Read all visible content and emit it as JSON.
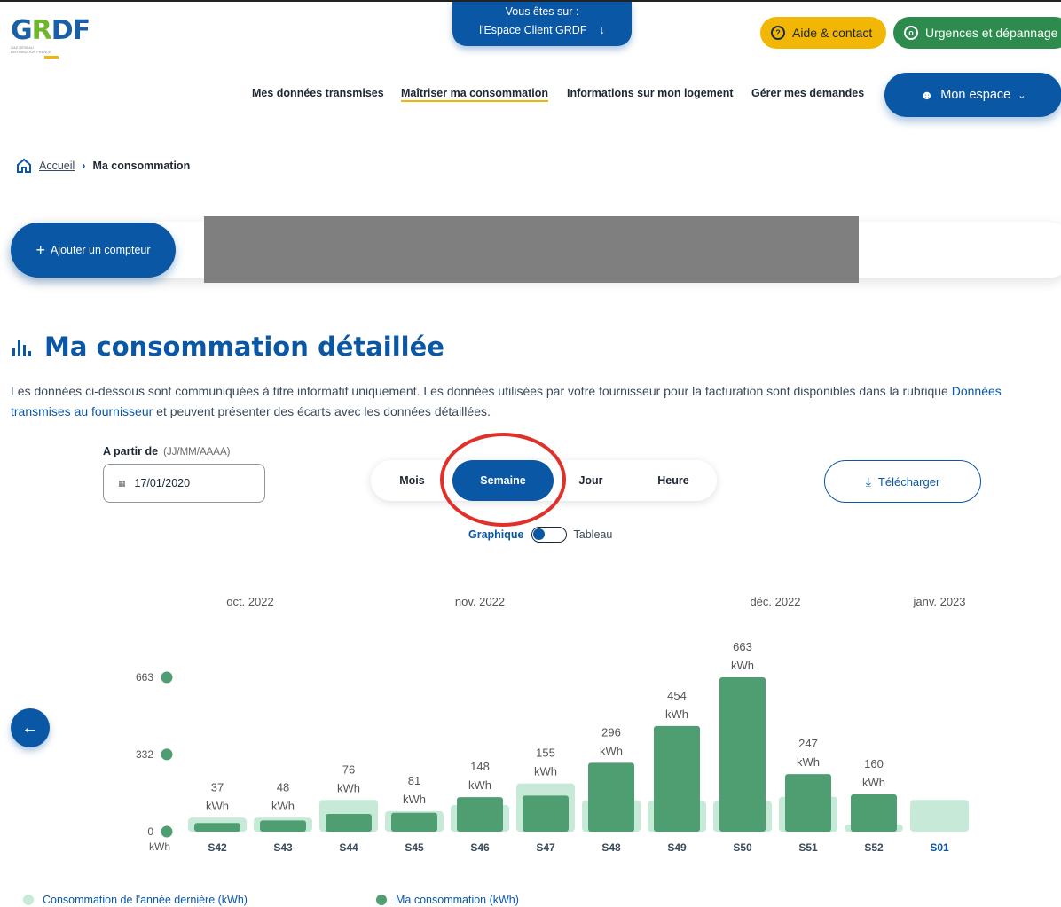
{
  "header": {
    "logo_text": "GRDF",
    "espace_line1": "Vous êtes sur :",
    "espace_line2": "l'Espace Client GRDF",
    "aide_label": "Aide & contact",
    "urgences_label": "Urgences et dépannage",
    "nav": [
      "Mes données transmises",
      "Maîtriser ma consommation",
      "Informations sur mon logement",
      "Gérer mes demandes"
    ],
    "mon_espace_label": "Mon espace"
  },
  "breadcrumb": {
    "home": "Accueil",
    "current": "Ma consommation"
  },
  "add_compteur_label": "Ajouter un compteur",
  "page": {
    "title": "Ma consommation détaillée",
    "desc_part1": "Les données ci-dessous sont communiquées à titre informatif uniquement. Les données utilisées par votre fournisseur pour la facturation sont disponibles dans la rubrique ",
    "desc_link": "Données transmises au fournisseur",
    "desc_part2": " et peuvent présenter des écarts avec les données détaillées."
  },
  "filters": {
    "date_label": "A partir de",
    "date_format": "(JJ/MM/AAAA)",
    "date_value": "17/01/2020",
    "periods": [
      "Mois",
      "Semaine",
      "Jour",
      "Heure"
    ],
    "active_period": "Semaine",
    "download_label": "Télécharger",
    "toggle_left": "Graphique",
    "toggle_right": "Tableau"
  },
  "colors": {
    "primary": "#0a57a5",
    "light_green": "#c6e9d8",
    "dark_green": "#4f9e72",
    "yellow": "#f2b705",
    "green_btn": "#2e8b4e",
    "annotation": "#e0302a"
  },
  "chart_data": {
    "type": "bar",
    "months": [
      "oct. 2022",
      "nov. 2022",
      "déc. 2022",
      "janv. 2023"
    ],
    "categories": [
      "S42",
      "S43",
      "S44",
      "S45",
      "S46",
      "S47",
      "S48",
      "S49",
      "S50",
      "S51",
      "S52",
      "S01"
    ],
    "series": [
      {
        "name": "Consommation de l'année dernière (kWh)",
        "values": [
          60,
          60,
          136,
          88,
          115,
          207,
          135,
          131,
          131,
          150,
          30,
          136
        ]
      },
      {
        "name": "Ma consommation (kWh)",
        "values": [
          37,
          48,
          76,
          81,
          148,
          155,
          296,
          454,
          663,
          247,
          160,
          null
        ]
      }
    ],
    "value_labels": [
      "37",
      "48",
      "76",
      "81",
      "148",
      "155",
      "296",
      "454",
      "663",
      "247",
      "160",
      ""
    ],
    "unit": "kWh",
    "yticks": [
      "0",
      "332",
      "663"
    ],
    "y_unit_label": "kWh",
    "ylim": [
      0,
      663
    ]
  }
}
